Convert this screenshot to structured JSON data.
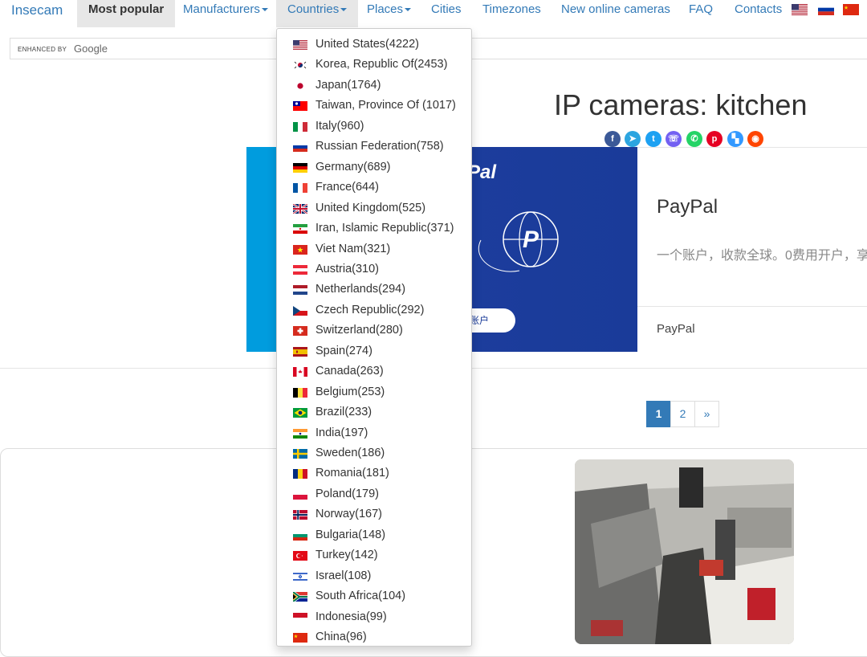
{
  "navbar": {
    "brand": "Insecam",
    "items": [
      {
        "label": "Most popular"
      },
      {
        "label": "Manufacturers"
      },
      {
        "label": "Countries"
      },
      {
        "label": "Places"
      },
      {
        "label": "Cities"
      },
      {
        "label": "Timezones"
      },
      {
        "label": "New online cameras"
      },
      {
        "label": "FAQ"
      },
      {
        "label": "Contacts"
      }
    ],
    "languages": [
      "en",
      "ru",
      "zh"
    ]
  },
  "search": {
    "enhanced_by": "ENHANCED BY",
    "provider": "Google"
  },
  "page_title": "IP cameras: kitchen",
  "share_icons": [
    "facebook-icon",
    "telegram-icon",
    "twitter-icon",
    "viber-icon",
    "whatsapp-icon",
    "pinterest-icon",
    "delicious-icon",
    "reddit-icon"
  ],
  "ad": {
    "image_brand": "Pal",
    "button": "账户",
    "title": "PayPal",
    "description": "一个账户，收款全球。0费用开户，享",
    "footer": "PayPal"
  },
  "pagination": {
    "pages": [
      "1",
      "2"
    ],
    "next": "»",
    "current": "1"
  },
  "countries": [
    {
      "label": "United States(4222)",
      "flag": "us"
    },
    {
      "label": "Korea, Republic Of(2453)",
      "flag": "kr"
    },
    {
      "label": "Japan(1764)",
      "flag": "jp"
    },
    {
      "label": "Taiwan, Province Of (1017)",
      "flag": "tw"
    },
    {
      "label": "Italy(960)",
      "flag": "it"
    },
    {
      "label": "Russian Federation(758)",
      "flag": "ru"
    },
    {
      "label": "Germany(689)",
      "flag": "de"
    },
    {
      "label": "France(644)",
      "flag": "fr"
    },
    {
      "label": "United Kingdom(525)",
      "flag": "gb"
    },
    {
      "label": "Iran, Islamic Republic(371)",
      "flag": "ir"
    },
    {
      "label": "Viet Nam(321)",
      "flag": "vn"
    },
    {
      "label": "Austria(310)",
      "flag": "at"
    },
    {
      "label": "Netherlands(294)",
      "flag": "nl"
    },
    {
      "label": "Czech Republic(292)",
      "flag": "cz"
    },
    {
      "label": "Switzerland(280)",
      "flag": "ch"
    },
    {
      "label": "Spain(274)",
      "flag": "es"
    },
    {
      "label": "Canada(263)",
      "flag": "ca"
    },
    {
      "label": "Belgium(253)",
      "flag": "be"
    },
    {
      "label": "Brazil(233)",
      "flag": "br"
    },
    {
      "label": "India(197)",
      "flag": "in"
    },
    {
      "label": "Sweden(186)",
      "flag": "se"
    },
    {
      "label": "Romania(181)",
      "flag": "ro"
    },
    {
      "label": "Poland(179)",
      "flag": "pl"
    },
    {
      "label": "Norway(167)",
      "flag": "no"
    },
    {
      "label": "Bulgaria(148)",
      "flag": "bg"
    },
    {
      "label": "Turkey(142)",
      "flag": "tr"
    },
    {
      "label": "Israel(108)",
      "flag": "il"
    },
    {
      "label": "South Africa(104)",
      "flag": "za"
    },
    {
      "label": "Indonesia(99)",
      "flag": "id"
    },
    {
      "label": "China(96)",
      "flag": "cn"
    }
  ]
}
